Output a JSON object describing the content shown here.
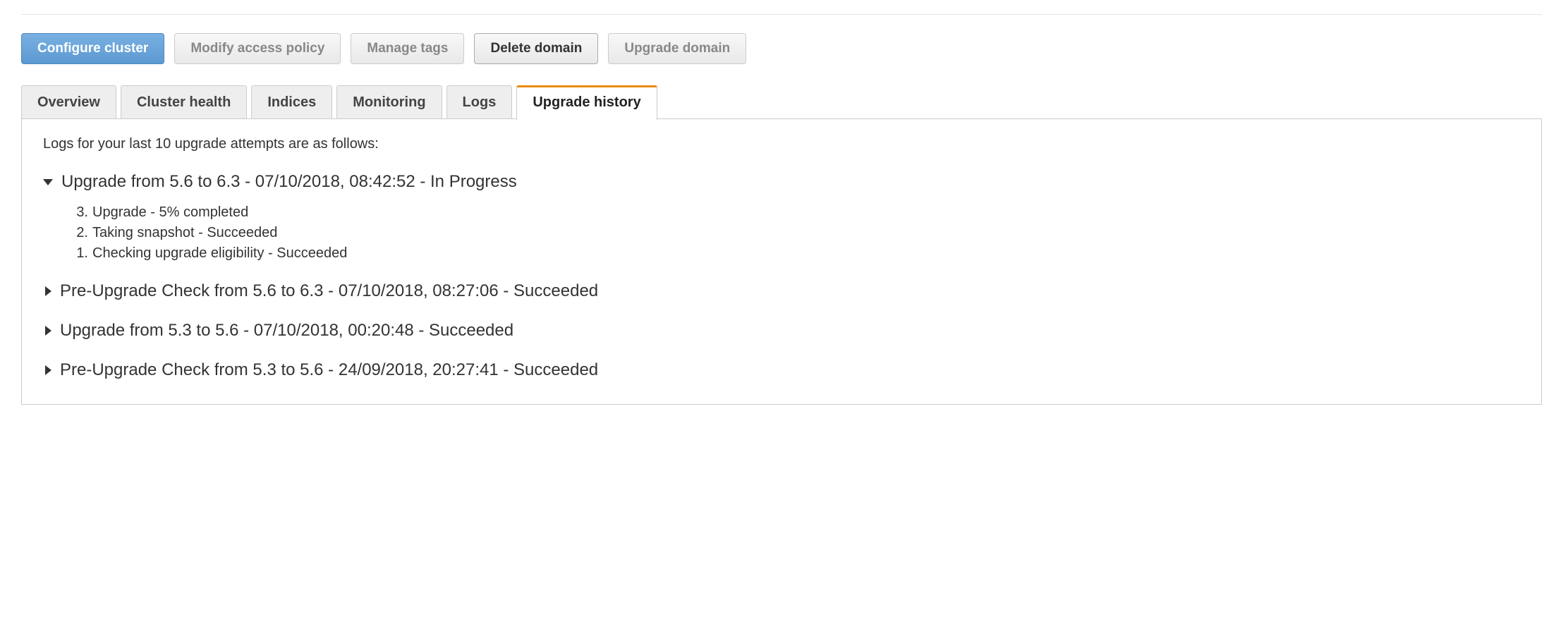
{
  "buttons": {
    "configure": "Configure cluster",
    "modify_access": "Modify access policy",
    "manage_tags": "Manage tags",
    "delete_domain": "Delete domain",
    "upgrade_domain": "Upgrade domain"
  },
  "tabs": {
    "overview": "Overview",
    "cluster_health": "Cluster health",
    "indices": "Indices",
    "monitoring": "Monitoring",
    "logs": "Logs",
    "upgrade_history": "Upgrade history"
  },
  "content": {
    "intro": "Logs for your last 10 upgrade attempts are as follows:"
  },
  "logs": [
    {
      "title": "Upgrade from 5.6 to 6.3 - 07/10/2018, 08:42:52 - In Progress",
      "expanded": true,
      "steps": [
        {
          "num": "3.",
          "text": "Upgrade - 5% completed"
        },
        {
          "num": "2.",
          "text": "Taking snapshot - Succeeded"
        },
        {
          "num": "1.",
          "text": "Checking upgrade eligibility - Succeeded"
        }
      ]
    },
    {
      "title": "Pre-Upgrade Check from 5.6 to 6.3 - 07/10/2018, 08:27:06 - Succeeded",
      "expanded": false
    },
    {
      "title": "Upgrade from 5.3 to 5.6 - 07/10/2018, 00:20:48 - Succeeded",
      "expanded": false
    },
    {
      "title": "Pre-Upgrade Check from 5.3 to 5.6 - 24/09/2018, 20:27:41 - Succeeded",
      "expanded": false
    }
  ]
}
